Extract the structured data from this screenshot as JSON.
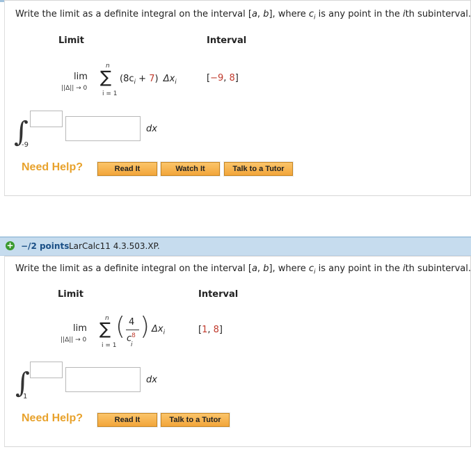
{
  "q1": {
    "prompt_prefix": "Write the limit as a definite integral on the interval [",
    "prompt_a": "a",
    "prompt_comma": ", ",
    "prompt_b": "b",
    "prompt_mid": "], where ",
    "prompt_c": "c",
    "prompt_i_sub": "i",
    "prompt_mid2": " is any point in the ",
    "prompt_ith": "i",
    "prompt_suffix": "th subinterval.",
    "limit_header": "Limit",
    "interval_header": "Interval",
    "lim": "lim",
    "lim_sub": "||Δ|| → 0",
    "sum_top": "n",
    "sum_bottom": "i = 1",
    "expr_open": "(8c",
    "expr_i": "i",
    "expr_plus": " + ",
    "expr_const": "7",
    "expr_close": ")",
    "delta": "Δx",
    "delta_i": "i",
    "interval_open": "[",
    "interval_a": "−9",
    "interval_comma": ", ",
    "interval_b": "8",
    "interval_close": "]",
    "lower_limit": "-9",
    "dx": "dx",
    "need_help": "Need Help?",
    "buttons": [
      "Read It",
      "Watch It",
      "Talk to a Tutor"
    ]
  },
  "q2": {
    "points": "−/2 points",
    "question_id": "LarCalc11 4.3.503.XP.",
    "prompt_prefix": "Write the limit as a definite integral on the interval [",
    "prompt_a": "a",
    "prompt_comma": ", ",
    "prompt_b": "b",
    "prompt_mid": "], where ",
    "prompt_c": "c",
    "prompt_i_sub": "i",
    "prompt_mid2": " is any point in the ",
    "prompt_ith": "i",
    "prompt_suffix": "th subinterval.",
    "limit_header": "Limit",
    "interval_header": "Interval",
    "lim": "lim",
    "lim_sub": "||Δ|| → 0",
    "sum_top": "n",
    "sum_bottom": "i = 1",
    "frac_num": "4",
    "frac_den": "c",
    "frac_den_sup": "8",
    "frac_den_sub": "i",
    "delta": "Δx",
    "delta_i": "i",
    "interval_open": "[",
    "interval_a": "1",
    "interval_comma": ", ",
    "interval_b": "8",
    "interval_close": "]",
    "lower_limit": "1",
    "dx": "dx",
    "need_help": "Need Help?",
    "buttons": [
      "Read It",
      "Talk to a Tutor"
    ]
  },
  "colors": {
    "accent_red": "#c0392b",
    "help_orange": "#e8a22c",
    "points_blue": "#1a4f86",
    "bar_blue": "#c6dcee"
  }
}
